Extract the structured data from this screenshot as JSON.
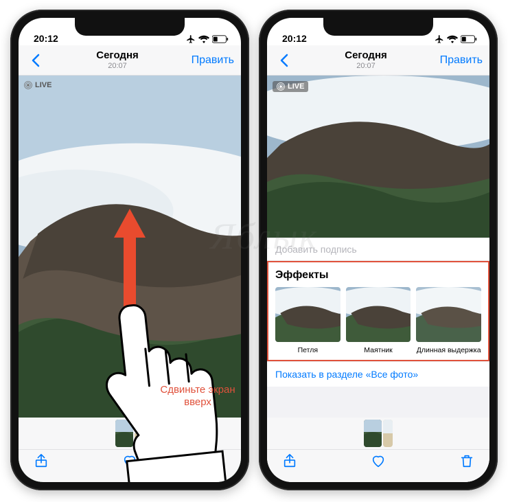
{
  "status": {
    "time": "20:12"
  },
  "nav": {
    "title": "Сегодня",
    "subtitle": "20:07",
    "edit_label": "Править"
  },
  "badges": {
    "live_label": "LIVE"
  },
  "instruction": {
    "text": "Сдвиньте экран вверх"
  },
  "right_panel": {
    "caption_placeholder": "Добавить подпись",
    "effects_title": "Эффекты",
    "effects": [
      {
        "label": "Петля"
      },
      {
        "label": "Маятник"
      },
      {
        "label": "Длинная выдержка"
      }
    ],
    "show_all_link": "Показать в разделе «Все фото»"
  },
  "watermark": "Яблык",
  "colors": {
    "accent": "#007aff",
    "hint_red": "#e0513b"
  }
}
